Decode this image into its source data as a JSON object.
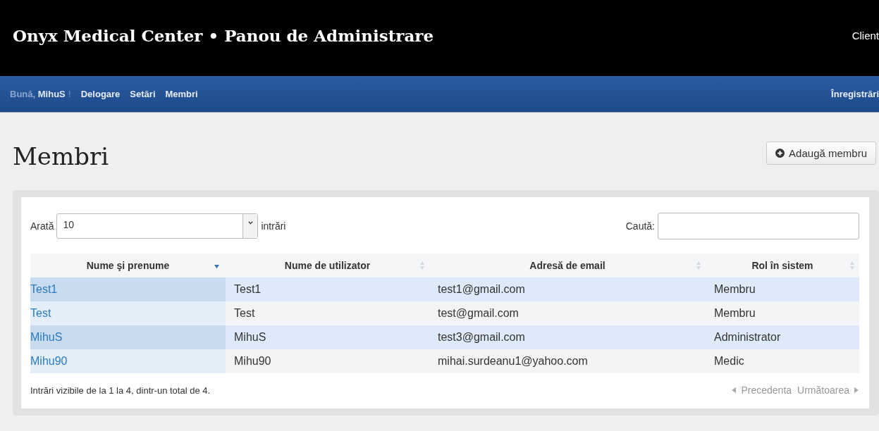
{
  "header": {
    "title": "Onyx Medical Center • Panou de Administrare",
    "right_link": "Client"
  },
  "nav": {
    "greeting": "Bună,",
    "user": "MihuS",
    "greeting_end": "!",
    "links": [
      "Delogare",
      "Setări",
      "Membri"
    ],
    "right_link": "Înregistrări"
  },
  "page": {
    "heading": "Membri",
    "add_button": "Adaugă membru"
  },
  "table_controls": {
    "show_label": "Arată",
    "page_size": "10",
    "entries_label": "intrări",
    "search_label": "Caută:"
  },
  "table": {
    "columns": [
      {
        "label": "Nume şi prenume",
        "sorted": true
      },
      {
        "label": "Nume de utilizator",
        "sorted": false
      },
      {
        "label": "Adresă de email",
        "sorted": false
      },
      {
        "label": "Rol în sistem",
        "sorted": false
      }
    ],
    "rows": [
      [
        "Test1",
        "Test1",
        "test1@gmail.com",
        "Membru"
      ],
      [
        "Test",
        "Test",
        "test@gmail.com",
        "Membru"
      ],
      [
        "MihuS",
        "MihuS",
        "test3@gmail.com",
        "Administrator"
      ],
      [
        "Mihu90",
        "Mihu90",
        "mihai.surdeanu1@yahoo.com",
        "Medic"
      ]
    ]
  },
  "footer": {
    "info": "Intrări vizibile de la 1 la 4, dintr-un total de 4.",
    "previous": {
      "label": "Precedenta",
      "disabled": true
    },
    "next": {
      "label": "Următoarea",
      "disabled": true
    }
  }
}
